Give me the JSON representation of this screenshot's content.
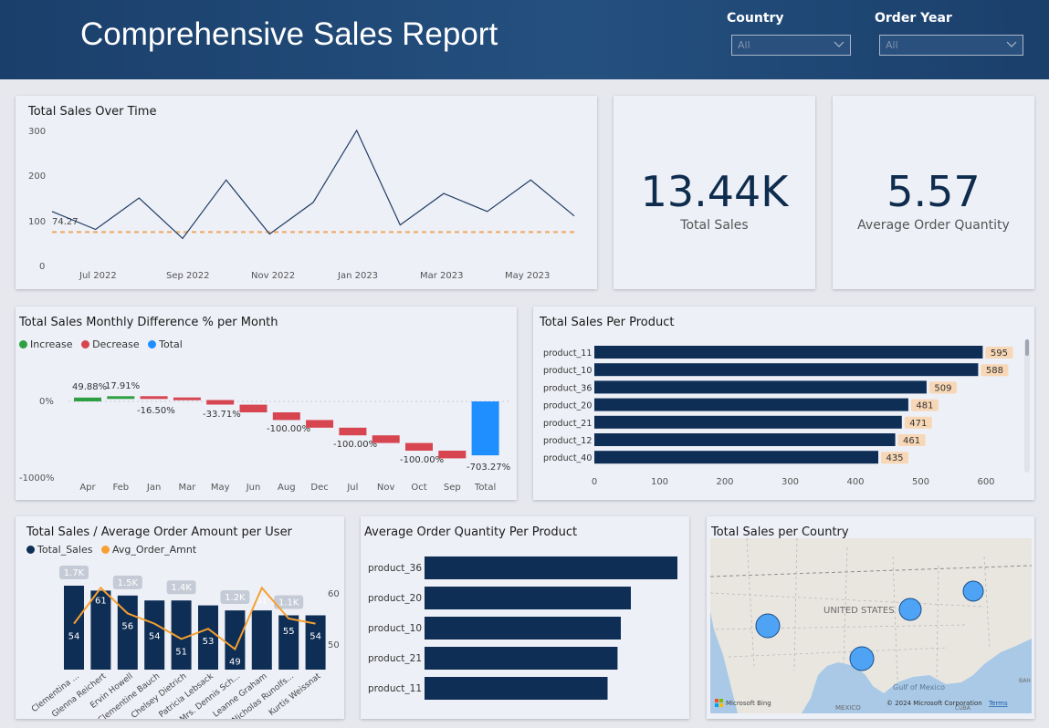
{
  "header": {
    "title": "Comprehensive Sales Report"
  },
  "filters": [
    {
      "label": "Country",
      "value": "All"
    },
    {
      "label": "Order Year",
      "value": "All"
    }
  ],
  "colors": {
    "navy": "#0f2e55",
    "increase": "#2ea043",
    "decrease": "#d64550",
    "total": "#1f8fff",
    "avg": "#f5a030"
  },
  "kpis": [
    {
      "value": "13.44K",
      "label": "Total Sales"
    },
    {
      "value": "5.57",
      "label": "Average Order Quantity"
    }
  ],
  "line_chart": {
    "title": "Total Sales Over Time",
    "avg_label": "74.27",
    "yticks": [
      "300",
      "200",
      "100",
      "0"
    ],
    "xticks": [
      "Jul 2022",
      "Sep 2022",
      "Nov 2022",
      "Jan 2023",
      "Mar 2023",
      "May 2023"
    ]
  },
  "waterfall": {
    "title": "Total Sales Monthly Difference % per Month",
    "legend": [
      "Increase",
      "Decrease",
      "Total"
    ],
    "yticks": [
      "0%",
      "-1000%"
    ],
    "labels": [
      "49.88%",
      "17.91%",
      "-16.50%",
      "-33.71%",
      "-100.00%",
      "-100.00%",
      "-100.00%",
      "-703.27%"
    ]
  },
  "product_bars": {
    "title": "Total Sales Per Product"
  },
  "combo": {
    "title": "Total Sales / Average Order Amount per User",
    "legend": [
      "Total_Sales",
      "Avg_Order_Amnt"
    ],
    "yticks_right": [
      "60",
      "50"
    ]
  },
  "avg_qty": {
    "title": "Average Order Quantity Per Product"
  },
  "map": {
    "title": "Total Sales per Country",
    "label_us": "UNITED STATES",
    "label_mexico": "MEXICO",
    "label_gulf": "Gulf of Mexico",
    "label_cuba": "CUBA",
    "label_bah": "BAH",
    "label_bing": "Microsoft Bing",
    "copyright": "© 2024 Microsoft Corporation",
    "terms": "Terms"
  },
  "chart_data": [
    {
      "type": "line",
      "title": "Total Sales Over Time",
      "x": [
        "2022-06",
        "2022-07",
        "2022-08",
        "2022-09",
        "2022-10",
        "2022-11",
        "2022-12",
        "2023-01",
        "2023-02",
        "2023-03",
        "2023-04",
        "2023-05",
        "2023-06"
      ],
      "series": [
        {
          "values": [
            120,
            80,
            150,
            60,
            190,
            70,
            140,
            300,
            90,
            160,
            120,
            190,
            110
          ]
        }
      ],
      "reference_line": 74.27,
      "ylim": [
        0,
        300
      ]
    },
    {
      "type": "bar",
      "title": "Total Sales Monthly Difference % per Month",
      "categories": [
        "Apr",
        "Feb",
        "Jan",
        "Mar",
        "May",
        "Jun",
        "Aug",
        "Dec",
        "Jul",
        "Nov",
        "Oct",
        "Sep",
        "Total"
      ],
      "values": [
        49.88,
        17.91,
        -16.5,
        -33.71,
        -60,
        -100,
        -100,
        -100,
        -100,
        -100,
        -100,
        -100,
        -703.27
      ],
      "ylim": [
        -1000,
        0
      ]
    },
    {
      "type": "bar",
      "title": "Total Sales Per Product",
      "categories": [
        "product_11",
        "product_10",
        "product_36",
        "product_20",
        "product_21",
        "product_12",
        "product_40"
      ],
      "values": [
        595,
        588,
        509,
        481,
        471,
        461,
        435
      ],
      "xlim": [
        0,
        600
      ],
      "xticks": [
        "0",
        "100",
        "200",
        "300",
        "400",
        "500",
        "600"
      ]
    },
    {
      "type": "bar",
      "title": "Total Sales / Average Order Amount per User",
      "categories": [
        "Clementina ...",
        "Glenna Reichert",
        "Ervin Howell",
        "Clementine Bauch",
        "Chelsey Dietrich",
        "Patricia Lebsack",
        "Mrs. Dennis Sch...",
        "Leanne Graham",
        "Nicholas Runolfs...",
        "Kurtis Weissnat"
      ],
      "series": [
        {
          "name": "Total_Sales",
          "values": [
            1700,
            1600,
            1500,
            1400,
            1400,
            1300,
            1200,
            1200,
            1100,
            1100
          ]
        },
        {
          "name": "Avg_Order_Amnt",
          "values": [
            54,
            61,
            56,
            54,
            51,
            53,
            49,
            61,
            55,
            54
          ]
        }
      ],
      "bar_labels": [
        "1.7K",
        "",
        "1.5K",
        "",
        "1.4K",
        "",
        "1.2K",
        "",
        "1.1K",
        ""
      ]
    },
    {
      "type": "bar",
      "title": "Average Order Quantity Per Product",
      "categories": [
        "product_36",
        "product_20",
        "product_10",
        "product_21",
        "product_11"
      ],
      "values": [
        7.6,
        6.2,
        5.9,
        5.8,
        5.5
      ]
    }
  ]
}
